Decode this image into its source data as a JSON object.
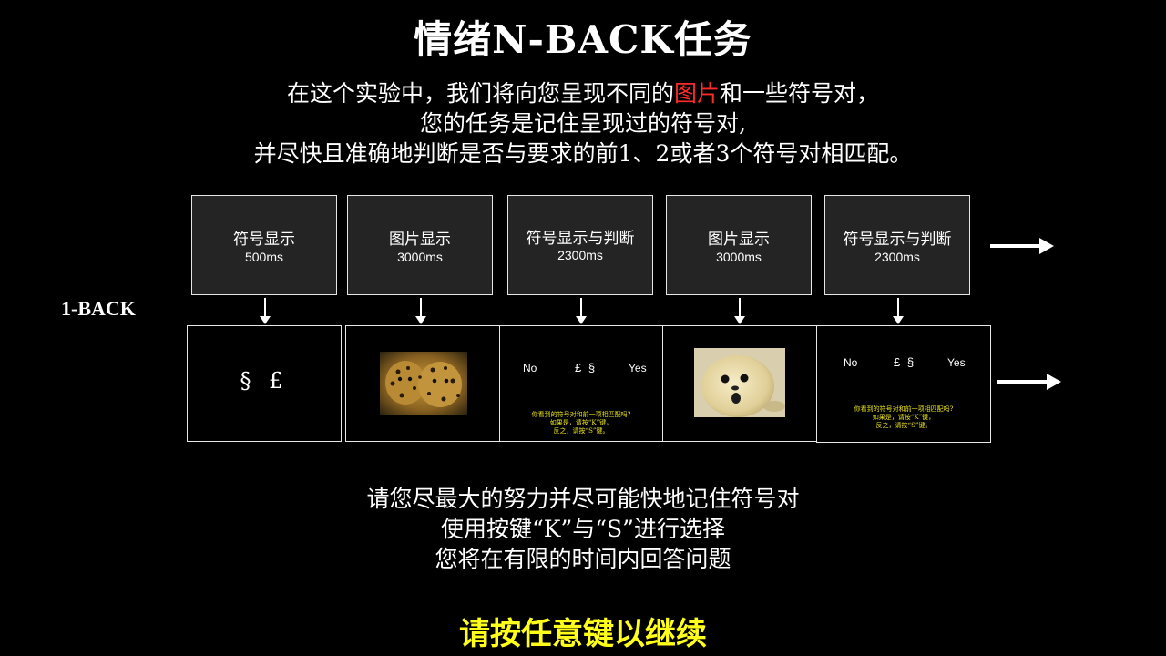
{
  "title": "情绪N-BACK任务",
  "intro": {
    "line1_before": "在这个实验中，我们将向您呈现不同的",
    "line1_highlight": "图片",
    "line1_after": "和一些符号对，",
    "line2": "您的任务是记住呈现过的符号对,",
    "line3": "并尽快且准确地判断是否与要求的前1、2或者3个符号对相匹配。"
  },
  "condition_label": "1-BACK",
  "stages": [
    {
      "name": "符号显示",
      "duration": "500ms"
    },
    {
      "name": "图片显示",
      "duration": "3000ms"
    },
    {
      "name": "符号显示与判断",
      "duration": "2300ms"
    },
    {
      "name": "图片显示",
      "duration": "3000ms"
    },
    {
      "name": "符号显示与判断",
      "duration": "2300ms"
    }
  ],
  "screens": {
    "symbol_pair": "§ £",
    "judge1": {
      "no": "No",
      "pair": "£ §",
      "yes": "Yes",
      "q1": "你看到的符号对和前一项相匹配吗?",
      "q2": "如果是，请按“K”键，",
      "q3": "反之，请按“S”键。"
    },
    "judge2": {
      "no": "No",
      "pair": "£ §",
      "yes": "Yes",
      "q1": "你看到的符号对和前一项相匹配吗?",
      "q2": "如果是，请按“K”键，",
      "q3": "反之，请按“S”键。"
    },
    "pic1_name": "leopard-cubs-photo",
    "pic2_name": "seal-pup-photo"
  },
  "instructions": [
    "请您尽最大的努力并尽可能快地记住符号对",
    "使用按键“K”与“S”进行选择",
    "您将在有限的时间内回答问题"
  ],
  "cta": "请按任意键以继续",
  "colors": {
    "background": "#000000",
    "text": "#ffffff",
    "highlight": "#ff2a2a",
    "cta": "#ffff1a",
    "question": "#e8e21b",
    "stage_box": "#242424"
  }
}
